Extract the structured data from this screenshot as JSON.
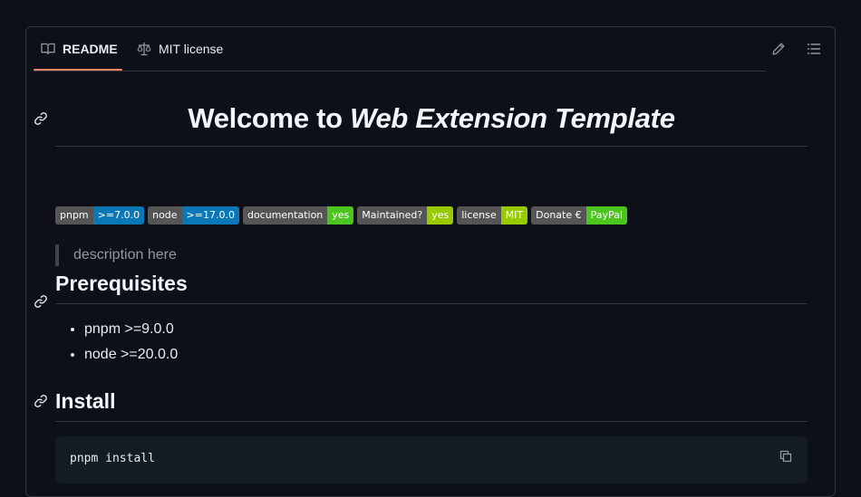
{
  "tabs": {
    "readme_label": "README",
    "license_label": "MIT license"
  },
  "title": {
    "prefix": "Welcome to ",
    "emphasis": "Web Extension Template"
  },
  "badges": [
    {
      "label": "pnpm",
      "message": ">=7.0.0",
      "color": "#0a77b6"
    },
    {
      "label": "node",
      "message": ">=17.0.0",
      "color": "#0a77b6"
    },
    {
      "label": "documentation",
      "message": "yes",
      "color": "#4cc61e"
    },
    {
      "label": "Maintained?",
      "message": "yes",
      "color": "#97ca00"
    },
    {
      "label": "license",
      "message": "MIT",
      "color": "#97ca00"
    },
    {
      "label": "Donate €",
      "message": "PayPal",
      "color": "#4cc61e"
    }
  ],
  "description": "description here",
  "prerequisites": {
    "heading": "Prerequisites",
    "items": [
      "pnpm >=9.0.0",
      "node >=20.0.0"
    ]
  },
  "install": {
    "heading": "Install",
    "code": "pnpm install"
  },
  "colors": {
    "background": "#0d1117",
    "border": "#30363d",
    "tab_underline": "#f78166",
    "code_background": "#151b23"
  }
}
